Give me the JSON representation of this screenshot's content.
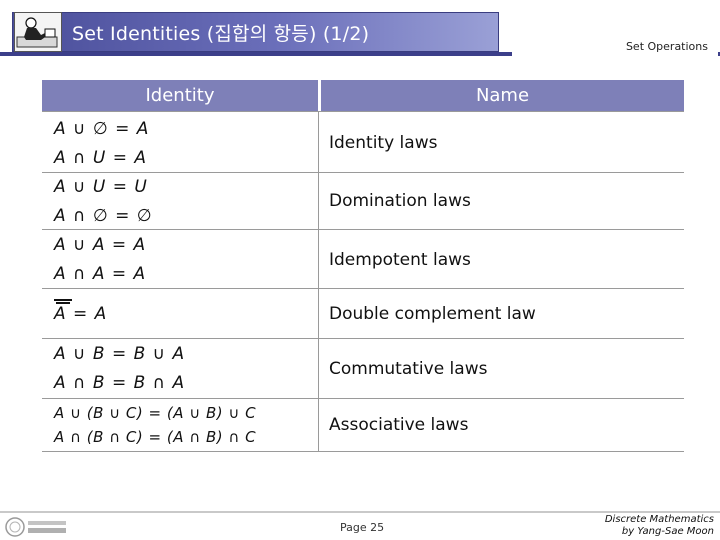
{
  "header": {
    "title": "Set Identities (집합의 항등) (1/2)",
    "topic": "Set Operations",
    "logo_icon": "professor-at-desk-icon",
    "accent": "#4a4e9a"
  },
  "table": {
    "col_identity": "Identity",
    "col_name": "Name",
    "header_color": "#7e80b8",
    "rows": [
      {
        "identities": [
          "A ∪ ∅ = A",
          "A ∩ U = A"
        ],
        "name": "Identity laws"
      },
      {
        "identities": [
          "A ∪ U = U",
          "A ∩ ∅ = ∅"
        ],
        "name": "Domination laws"
      },
      {
        "identities": [
          "A ∪ A = A",
          "A ∩ A = A"
        ],
        "name": "Idempotent laws"
      },
      {
        "identities": [
          "A = A"
        ],
        "name": "Double complement law"
      },
      {
        "identities": [
          "A ∪ B = B ∪ A",
          "A ∩ B = B ∩ A"
        ],
        "name": "Commutative laws"
      },
      {
        "identities": [
          "A ∪ (B ∪ C) = (A ∪ B) ∪ C",
          "A ∩ (B ∩ C) = (A ∩ B) ∩ C"
        ],
        "name": "Associative laws"
      }
    ]
  },
  "footer": {
    "page": "Page 25",
    "credit_line1": "Discrete Mathematics",
    "credit_line2": "by Yang-Sae Moon",
    "logo_icon": "university-logo-icon"
  }
}
